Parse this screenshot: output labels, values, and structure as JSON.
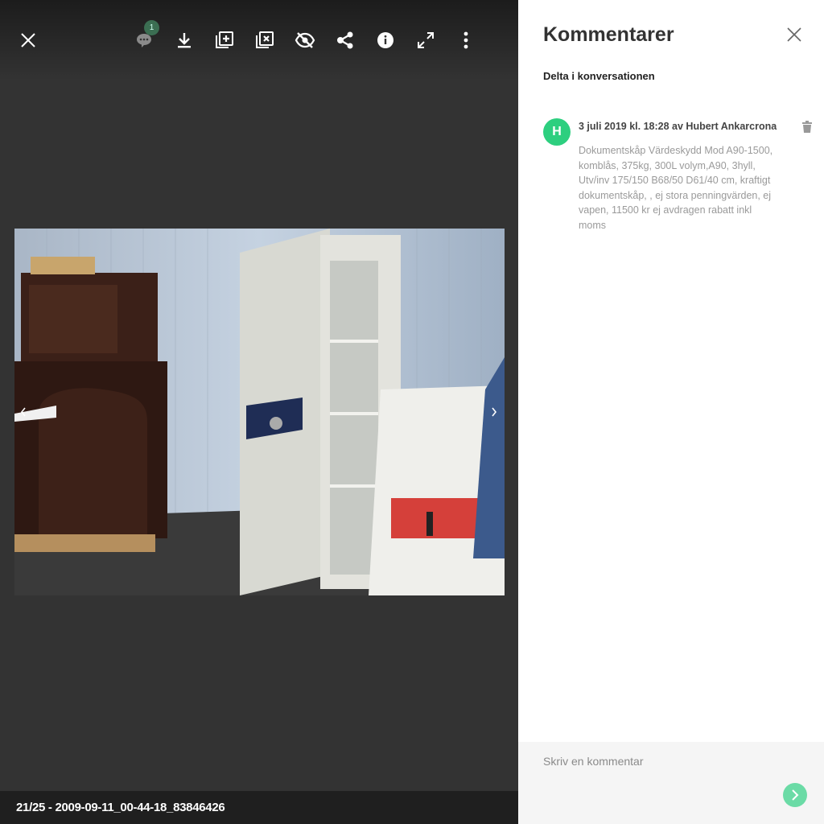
{
  "viewer": {
    "comment_badge_count": "1",
    "caption": "21/25 - 2009-09-11_00-44-18_83846426",
    "toolbar_icons": [
      "close-icon",
      "comment-icon",
      "download-icon",
      "add-to-album-icon",
      "remove-from-album-icon",
      "hide-icon",
      "share-icon",
      "info-icon",
      "fullscreen-icon",
      "more-icon"
    ]
  },
  "sidebar": {
    "title": "Kommentarer",
    "subtitle": "Delta i konversationen",
    "comments": [
      {
        "avatar_letter": "H",
        "avatar_color": "#2dcf7f",
        "meta": "3 juli 2019 kl. 18:28 av Hubert Ankarcrona",
        "text": "Dokumentskåp Värdeskydd Mod A90-1500, komblås, 375kg, 300L volym,A90, 3hyll, Utv/inv 175/150 B68/50 D61/40 cm, kraftigt dokumentskåp, , ej stora penningvärden, ej vapen, 11500 kr ej avdragen rabatt inkl moms"
      }
    ],
    "compose_placeholder": "Skriv en kommentar"
  }
}
